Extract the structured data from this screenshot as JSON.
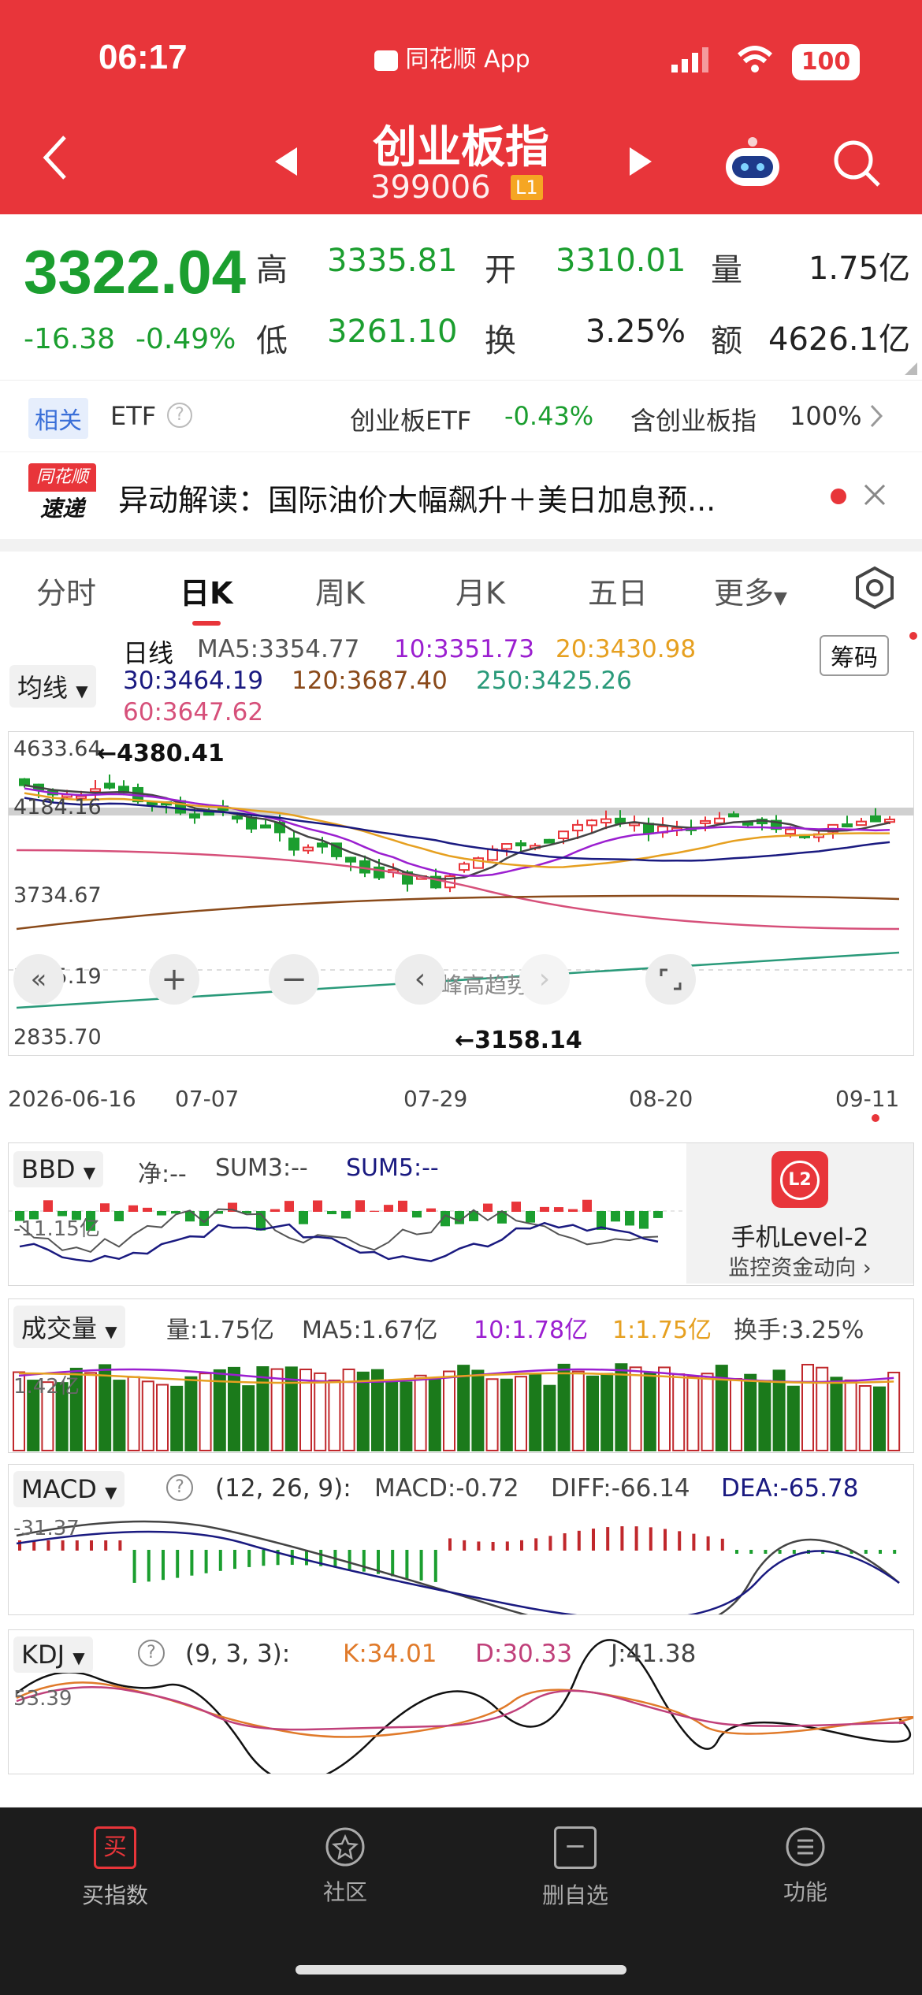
{
  "status": {
    "time": "06:17",
    "app": "同花顺 App",
    "battery": "100"
  },
  "header": {
    "title": "创业板指",
    "code": "399006",
    "level": "L1"
  },
  "quote": {
    "price": "3322.04",
    "change": "-16.38",
    "pct": "-0.49%",
    "high_label": "高",
    "high": "3335.81",
    "open_label": "开",
    "open": "3310.01",
    "vol_label": "量",
    "vol": "1.75亿",
    "low_label": "低",
    "low": "3261.10",
    "turn_label": "换",
    "turn": "3.25%",
    "amt_label": "额",
    "amt": "4626.1亿"
  },
  "etf": {
    "tag": "相关",
    "etf_label": "ETF",
    "fund_name": "创业板ETF",
    "fund_chg": "-0.43%",
    "holding": "含创业板指",
    "holding_pct": "100%"
  },
  "news": {
    "logo_top": "同花顺",
    "logo_bottom": "速递",
    "text": "异动解读：国际油价大幅飙升＋美日加息预..."
  },
  "tabs": [
    {
      "label": "分时"
    },
    {
      "label": "日K"
    },
    {
      "label": "周K"
    },
    {
      "label": "月K"
    },
    {
      "label": "五日"
    },
    {
      "label": "更多"
    }
  ],
  "ma": {
    "selector": "均线",
    "period": "日线",
    "ma5": "MA5:3354.77",
    "ma10": "10:3351.73",
    "ma20": "20:3430.98",
    "ma30": "30:3464.19",
    "ma120": "120:3687.40",
    "ma250": "250:3425.26",
    "ma60": "60:3647.62",
    "chips": "筹码"
  },
  "kline": {
    "y_labels": [
      "4633.64",
      "4184.16",
      "3734.67",
      "3285.19",
      "2835.70"
    ],
    "high_mark": "←4380.41",
    "low_mark": "←3158.14",
    "dates": [
      "2026-06-16",
      "07-07",
      "07-29",
      "08-20",
      "09-11"
    ],
    "watermark": "@峰高趋势"
  },
  "bbd": {
    "selector": "BBD",
    "net": "净:--",
    "sum3": "SUM3:--",
    "sum5": "SUM5:--",
    "y_label": "-11.15亿",
    "ad_title": "手机Level-2",
    "ad_sub": "监控资金动向",
    "ad_icon": "L2"
  },
  "volume": {
    "selector": "成交量",
    "vol": "量:1.75亿",
    "ma5": "MA5:1.67亿",
    "ma10": "10:1.78亿",
    "ma1": "1:1.75亿",
    "turn": "换手:3.25%",
    "y_label": "1.42亿"
  },
  "macd": {
    "selector": "MACD",
    "params": "(12, 26, 9):",
    "macd": "MACD:-0.72",
    "diff": "DIFF:-66.14",
    "dea": "DEA:-65.78",
    "y_label": "-31.37"
  },
  "kdj": {
    "selector": "KDJ",
    "params": "(9, 3, 3):",
    "k": "K:34.01",
    "d": "D:30.33",
    "j": "J:41.38",
    "y_label": "53.39"
  },
  "bottom_nav": [
    {
      "label": "买指数",
      "icon": "买"
    },
    {
      "label": "社区"
    },
    {
      "label": "删自选"
    },
    {
      "label": "功能"
    }
  ],
  "colors": {
    "red": "#e8353a",
    "green": "#1b9e2f",
    "purple": "#9b1fd0",
    "navy": "#1a1a80",
    "orange": "#e6a020",
    "brown": "#8a4a1a",
    "teal": "#2a9a7a",
    "pink": "#d6507a"
  }
}
